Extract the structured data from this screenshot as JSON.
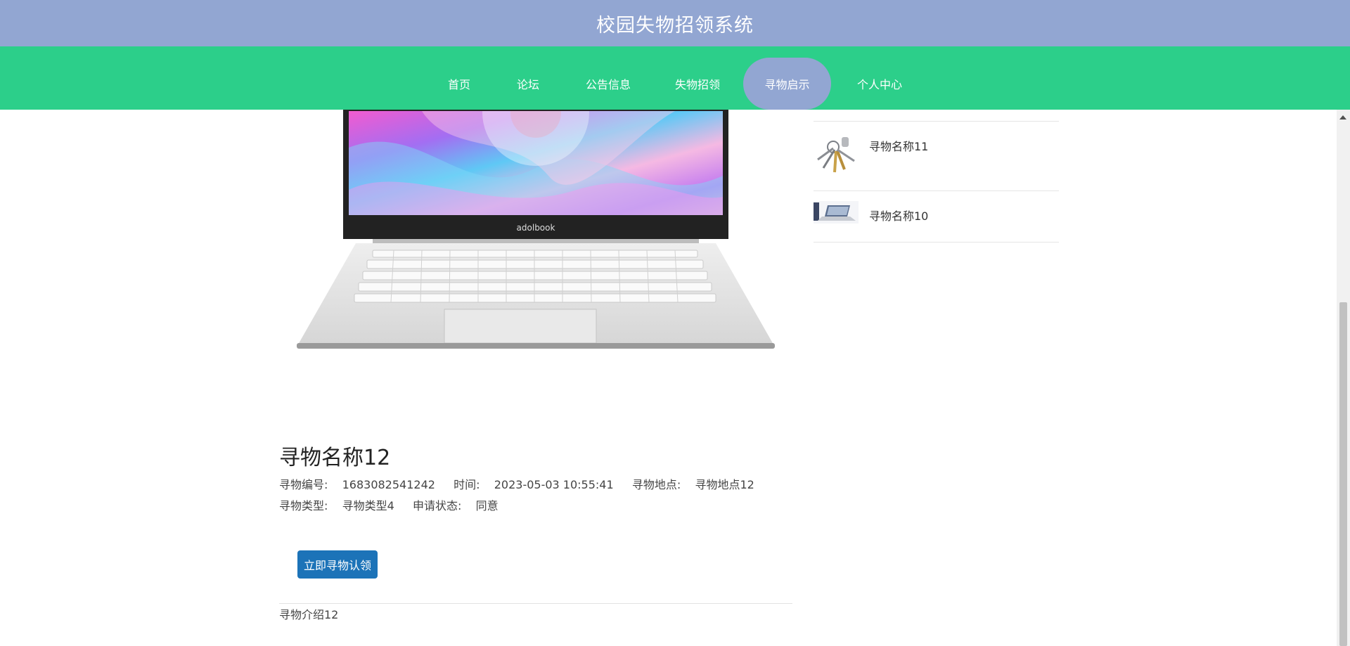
{
  "app": {
    "title": "校园失物招领系统"
  },
  "nav": {
    "items": [
      {
        "label": "首页"
      },
      {
        "label": "论坛"
      },
      {
        "label": "公告信息"
      },
      {
        "label": "失物招领"
      },
      {
        "label": "寻物启示",
        "active": true
      },
      {
        "label": "个人中心"
      }
    ]
  },
  "detail": {
    "image_brand_text": "adolbook",
    "name": "寻物名称12",
    "number_label": "寻物编号:",
    "number_value": "1683082541242",
    "time_label": "时间:",
    "time_value": "2023-05-03 10:55:41",
    "place_label": "寻物地点:",
    "place_value": "寻物地点12",
    "type_label": "寻物类型:",
    "type_value": "寻物类型4",
    "status_label": "申请状态:",
    "status_value": "同意",
    "claim_button": "立即寻物认领",
    "intro": "寻物介绍12"
  },
  "sidebar": {
    "items": [
      {
        "name": "寻物名称11",
        "thumb": "keys-image"
      },
      {
        "name": "寻物名称10",
        "thumb": "laptop-image"
      }
    ]
  },
  "colors": {
    "topbar": "#92a6d2",
    "navbar": "#2ccf8a",
    "nav_active": "#92a6d2",
    "button": "#1c73b8"
  }
}
